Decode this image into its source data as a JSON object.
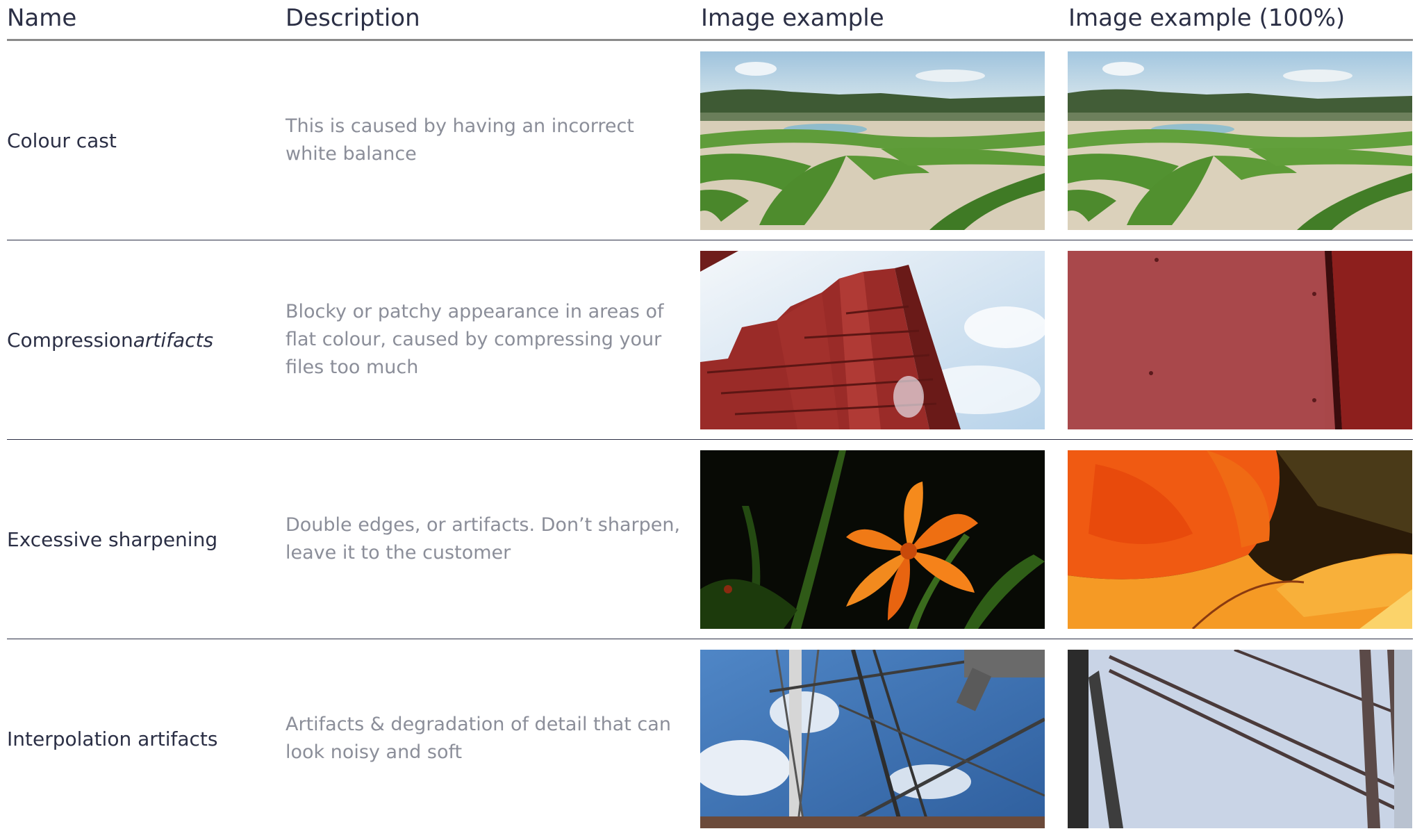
{
  "header": {
    "name": "Name",
    "description": "Description",
    "image_example": "Image example",
    "image_example_100": "Image example (100%)"
  },
  "rows": [
    {
      "name": "Colour cast",
      "name_italic": "",
      "description": "This is caused by having an incorrect white balance",
      "image": "formal garden with hedge patterns, cyan colour cast",
      "image_100": "same formal garden shown at 100%"
    },
    {
      "name": "Compression ",
      "name_italic": "artifacts",
      "description": "Blocky or patchy appearance in areas of flat colour, caused by compressing your files too much",
      "image": "red building facade against the sky",
      "image_100": "close-up of flat red facade panel"
    },
    {
      "name": "Excessive sharpening",
      "name_italic": "",
      "description": "Double edges, or artifacts. Don’t sharpen, leave it to the customer",
      "image": "orange lily flower on dark background",
      "image_100": "close-up of orange petals with sharpening halos"
    },
    {
      "name": "Interpolation artifacts",
      "name_italic": "",
      "description": "Artifacts & degradation of detail that can look noisy and soft",
      "image": "glass roof structure against blue sky",
      "image_100": "close-up of glass roof frame bars"
    }
  ]
}
